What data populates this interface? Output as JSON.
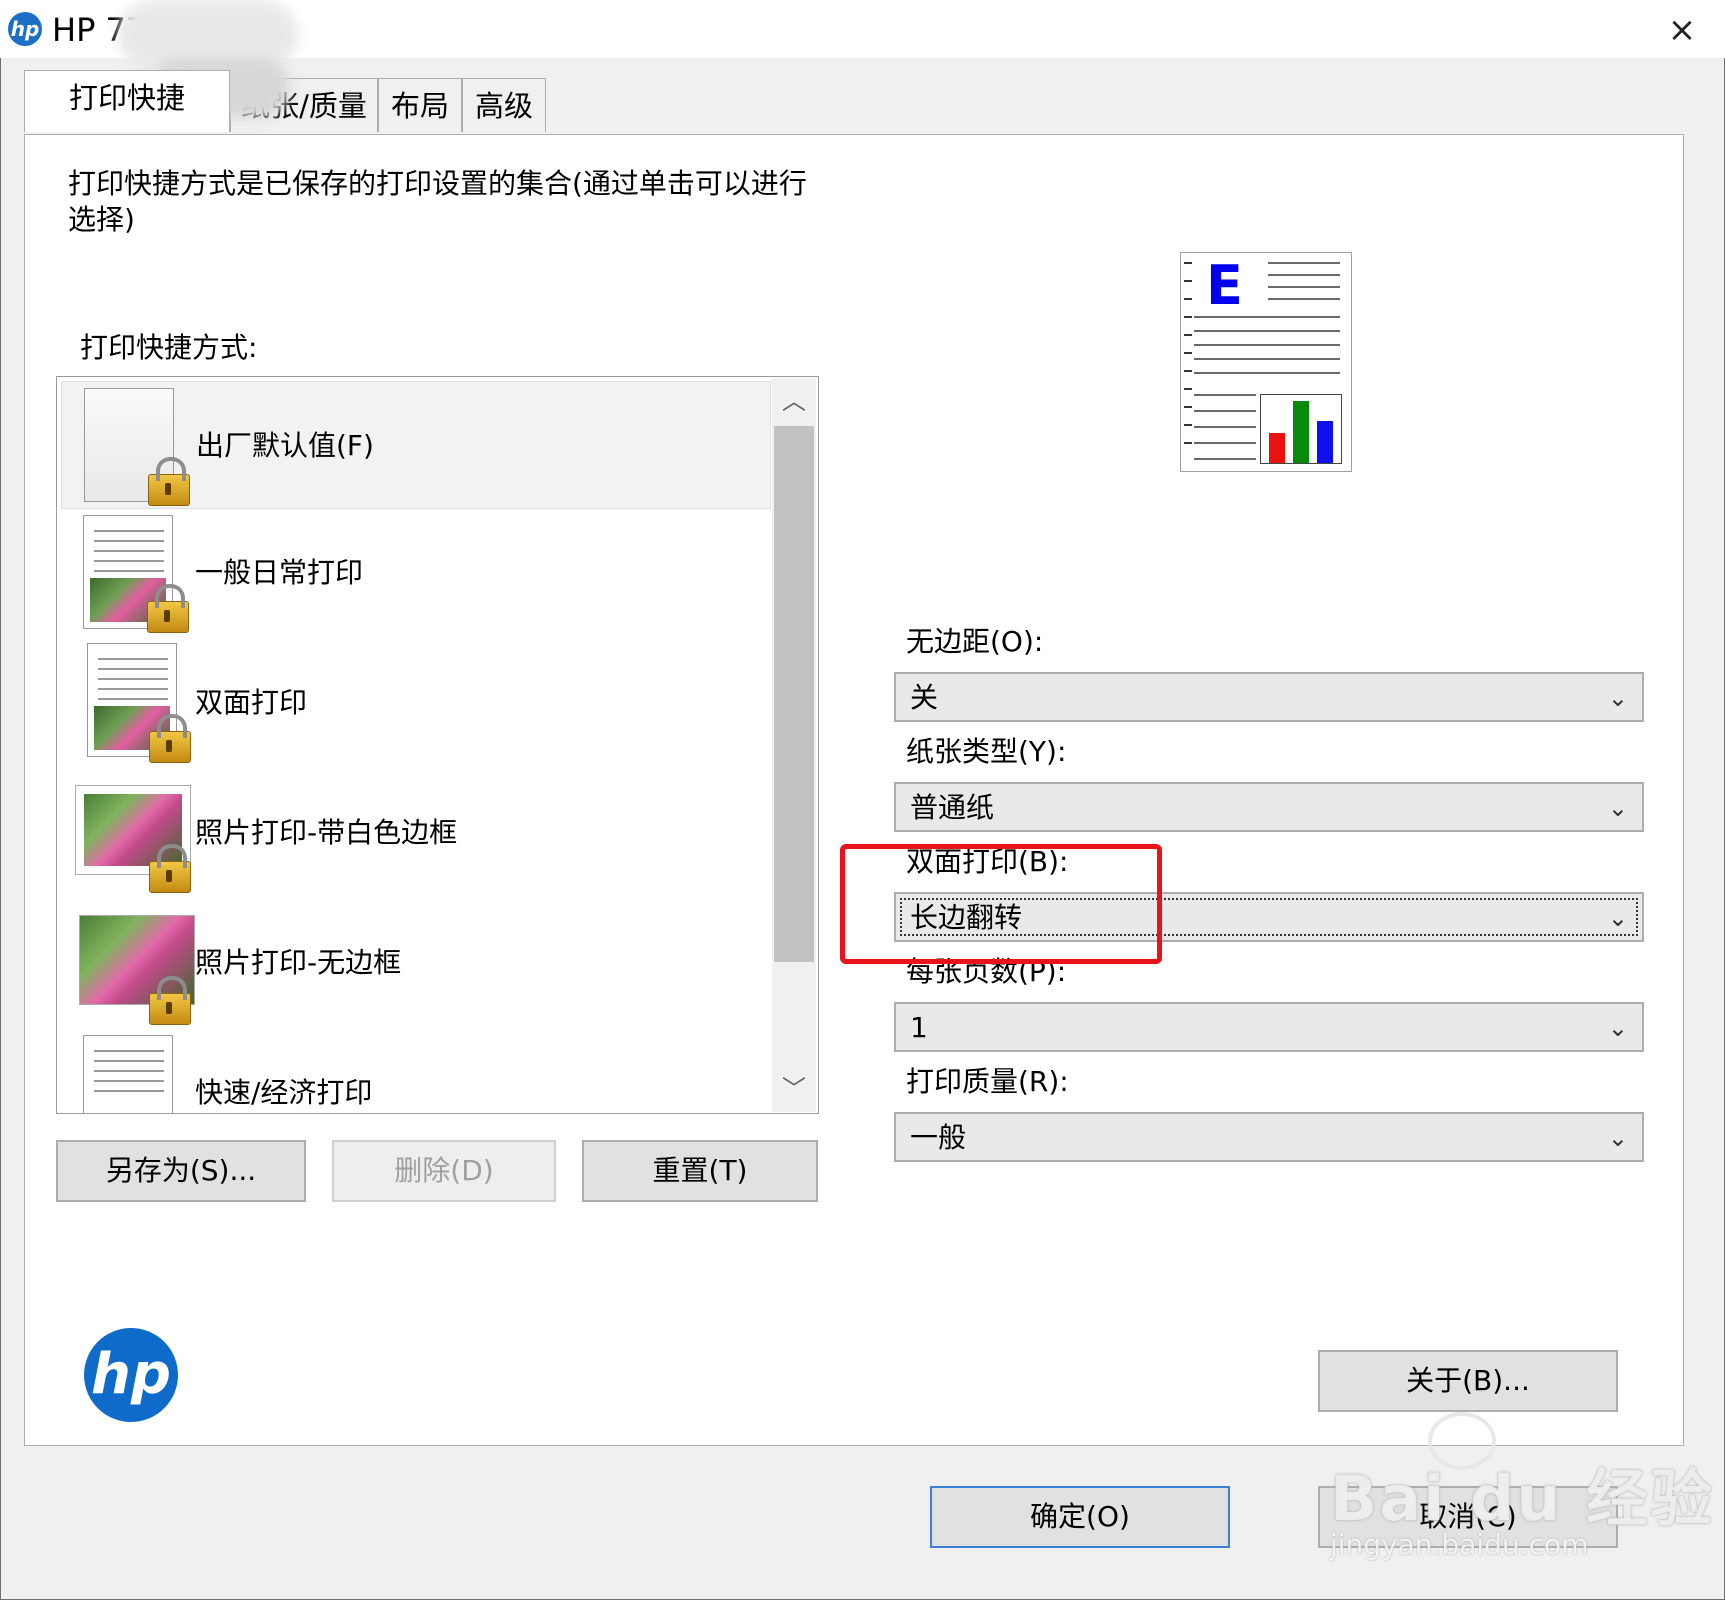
{
  "window": {
    "title": "HP 77",
    "close": "×"
  },
  "tabs": [
    "打印快捷",
    "纸张/质量",
    "布局",
    "高级"
  ],
  "shortcuts_panel": {
    "description": "打印快捷方式是已保存的打印设置的集合(通过单击可以进行选择)",
    "list_label": "打印快捷方式:",
    "items": [
      {
        "label": "出厂默认值(F)",
        "selected": true
      },
      {
        "label": "一般日常打印"
      },
      {
        "label": "双面打印"
      },
      {
        "label": "照片打印-带白色边框"
      },
      {
        "label": "照片打印-无边框"
      },
      {
        "label": "快速/经济打印"
      }
    ]
  },
  "buttons": {
    "save_as": "另存为(S)...",
    "delete": "删除(D)",
    "reset": "重置(T)",
    "about": "关于(B)...",
    "ok": "确定(O)",
    "cancel": "取消(C)"
  },
  "settings": {
    "borderless": {
      "label": "无边距(O):",
      "value": "关"
    },
    "paper_type": {
      "label": "纸张类型(Y):",
      "value": "普通纸"
    },
    "duplex": {
      "label": "双面打印(B):",
      "value": "长边翻转"
    },
    "pages_per_sheet": {
      "label": "每张页数(P):",
      "value": "1"
    },
    "print_quality": {
      "label": "打印质量(R):",
      "value": "一般"
    }
  },
  "icons": {
    "chevron_down": "⌄",
    "scroll_up": "︿",
    "scroll_down": "﹀"
  },
  "preview": {
    "letter": "E"
  },
  "logo": {
    "text": "hp"
  },
  "watermark": {
    "main": "Bai du 经验",
    "sub": "jingyan.baidu.com"
  },
  "colors": {
    "highlight": "#e8141a",
    "hp_blue": "#0f6bc9"
  }
}
